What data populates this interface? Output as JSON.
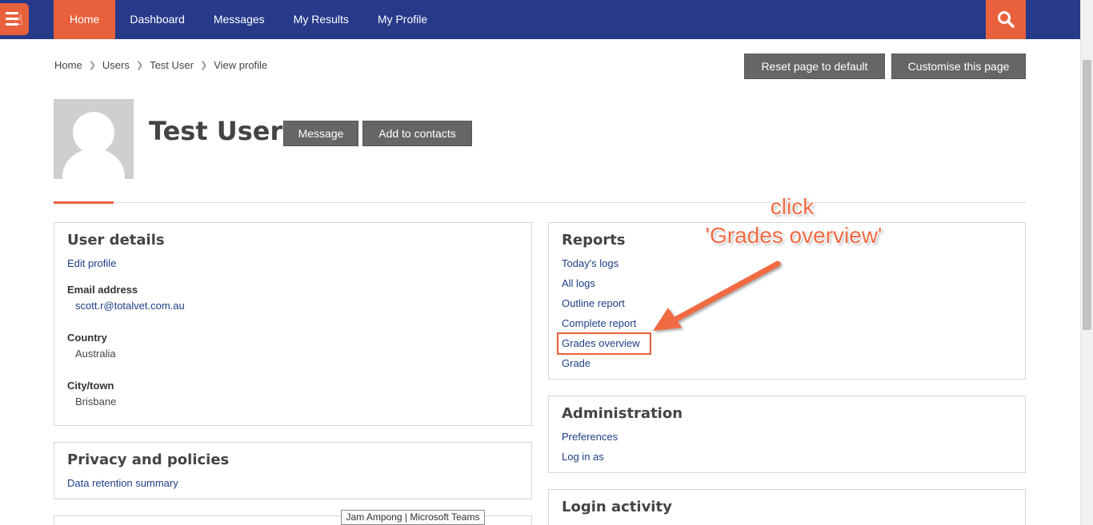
{
  "navbar": {
    "items": [
      {
        "label": "Home",
        "active": true
      },
      {
        "label": "Dashboard"
      },
      {
        "label": "Messages"
      },
      {
        "label": "My Results"
      },
      {
        "label": "My Profile"
      }
    ],
    "menu_icon": "hamburger-icon",
    "search_icon": "search-icon",
    "colors": {
      "bar": "#273a8a",
      "accent": "#e8613c"
    }
  },
  "breadcrumb": [
    "Home",
    "Users",
    "Test User",
    "View profile"
  ],
  "page_buttons": {
    "reset": "Reset page to default",
    "customise": "Customise this page"
  },
  "profile": {
    "name": "Test User",
    "message_label": "Message",
    "add_contacts_label": "Add to contacts"
  },
  "user_details": {
    "title": "User details",
    "edit_profile": "Edit profile",
    "email_label": "Email address",
    "email_value": "scott.r@totalvet.com.au",
    "country_label": "Country",
    "country_value": "Australia",
    "city_label": "City/town",
    "city_value": "Brisbane"
  },
  "privacy": {
    "title": "Privacy and policies",
    "link": "Data retention summary"
  },
  "reports": {
    "title": "Reports",
    "links": [
      "Today's logs",
      "All logs",
      "Outline report",
      "Complete report",
      "Grades overview",
      "Grade"
    ]
  },
  "administration": {
    "title": "Administration",
    "links": [
      "Preferences",
      "Log in as"
    ]
  },
  "login_activity": {
    "title": "Login activity"
  },
  "annotation": {
    "line1": "click",
    "line2": "'Grades overview'",
    "color": "#f06a43"
  },
  "tooltip": "Jam Ampong | Microsoft Teams"
}
